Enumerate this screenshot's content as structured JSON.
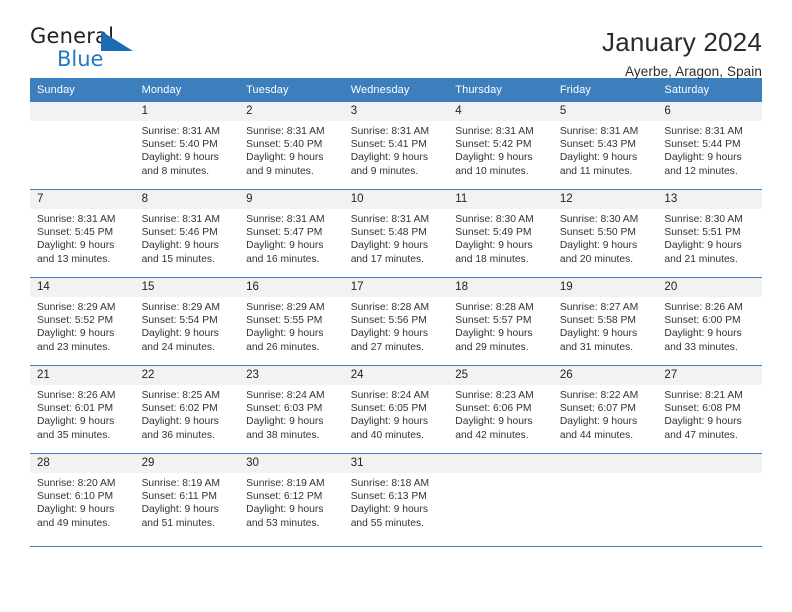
{
  "brand": {
    "name_part1": "General",
    "name_part2": "Blue",
    "color_blue": "#1f7ac4",
    "color_dark": "#231f20",
    "triangle_icon": "triangle-icon"
  },
  "header": {
    "title": "January 2024",
    "subtitle": "Ayerbe, Aragon, Spain"
  },
  "calendar": {
    "accent_color": "#3d7ebd",
    "daynum_bg": "#f2f2f2",
    "day_headers": [
      "Sunday",
      "Monday",
      "Tuesday",
      "Wednesday",
      "Thursday",
      "Friday",
      "Saturday"
    ],
    "weeks": [
      [
        {
          "day": "",
          "lines": []
        },
        {
          "day": "1",
          "lines": [
            "Sunrise: 8:31 AM",
            "Sunset: 5:40 PM",
            "Daylight: 9 hours",
            "and 8 minutes."
          ]
        },
        {
          "day": "2",
          "lines": [
            "Sunrise: 8:31 AM",
            "Sunset: 5:40 PM",
            "Daylight: 9 hours",
            "and 9 minutes."
          ]
        },
        {
          "day": "3",
          "lines": [
            "Sunrise: 8:31 AM",
            "Sunset: 5:41 PM",
            "Daylight: 9 hours",
            "and 9 minutes."
          ]
        },
        {
          "day": "4",
          "lines": [
            "Sunrise: 8:31 AM",
            "Sunset: 5:42 PM",
            "Daylight: 9 hours",
            "and 10 minutes."
          ]
        },
        {
          "day": "5",
          "lines": [
            "Sunrise: 8:31 AM",
            "Sunset: 5:43 PM",
            "Daylight: 9 hours",
            "and 11 minutes."
          ]
        },
        {
          "day": "6",
          "lines": [
            "Sunrise: 8:31 AM",
            "Sunset: 5:44 PM",
            "Daylight: 9 hours",
            "and 12 minutes."
          ]
        }
      ],
      [
        {
          "day": "7",
          "lines": [
            "Sunrise: 8:31 AM",
            "Sunset: 5:45 PM",
            "Daylight: 9 hours",
            "and 13 minutes."
          ]
        },
        {
          "day": "8",
          "lines": [
            "Sunrise: 8:31 AM",
            "Sunset: 5:46 PM",
            "Daylight: 9 hours",
            "and 15 minutes."
          ]
        },
        {
          "day": "9",
          "lines": [
            "Sunrise: 8:31 AM",
            "Sunset: 5:47 PM",
            "Daylight: 9 hours",
            "and 16 minutes."
          ]
        },
        {
          "day": "10",
          "lines": [
            "Sunrise: 8:31 AM",
            "Sunset: 5:48 PM",
            "Daylight: 9 hours",
            "and 17 minutes."
          ]
        },
        {
          "day": "11",
          "lines": [
            "Sunrise: 8:30 AM",
            "Sunset: 5:49 PM",
            "Daylight: 9 hours",
            "and 18 minutes."
          ]
        },
        {
          "day": "12",
          "lines": [
            "Sunrise: 8:30 AM",
            "Sunset: 5:50 PM",
            "Daylight: 9 hours",
            "and 20 minutes."
          ]
        },
        {
          "day": "13",
          "lines": [
            "Sunrise: 8:30 AM",
            "Sunset: 5:51 PM",
            "Daylight: 9 hours",
            "and 21 minutes."
          ]
        }
      ],
      [
        {
          "day": "14",
          "lines": [
            "Sunrise: 8:29 AM",
            "Sunset: 5:52 PM",
            "Daylight: 9 hours",
            "and 23 minutes."
          ]
        },
        {
          "day": "15",
          "lines": [
            "Sunrise: 8:29 AM",
            "Sunset: 5:54 PM",
            "Daylight: 9 hours",
            "and 24 minutes."
          ]
        },
        {
          "day": "16",
          "lines": [
            "Sunrise: 8:29 AM",
            "Sunset: 5:55 PM",
            "Daylight: 9 hours",
            "and 26 minutes."
          ]
        },
        {
          "day": "17",
          "lines": [
            "Sunrise: 8:28 AM",
            "Sunset: 5:56 PM",
            "Daylight: 9 hours",
            "and 27 minutes."
          ]
        },
        {
          "day": "18",
          "lines": [
            "Sunrise: 8:28 AM",
            "Sunset: 5:57 PM",
            "Daylight: 9 hours",
            "and 29 minutes."
          ]
        },
        {
          "day": "19",
          "lines": [
            "Sunrise: 8:27 AM",
            "Sunset: 5:58 PM",
            "Daylight: 9 hours",
            "and 31 minutes."
          ]
        },
        {
          "day": "20",
          "lines": [
            "Sunrise: 8:26 AM",
            "Sunset: 6:00 PM",
            "Daylight: 9 hours",
            "and 33 minutes."
          ]
        }
      ],
      [
        {
          "day": "21",
          "lines": [
            "Sunrise: 8:26 AM",
            "Sunset: 6:01 PM",
            "Daylight: 9 hours",
            "and 35 minutes."
          ]
        },
        {
          "day": "22",
          "lines": [
            "Sunrise: 8:25 AM",
            "Sunset: 6:02 PM",
            "Daylight: 9 hours",
            "and 36 minutes."
          ]
        },
        {
          "day": "23",
          "lines": [
            "Sunrise: 8:24 AM",
            "Sunset: 6:03 PM",
            "Daylight: 9 hours",
            "and 38 minutes."
          ]
        },
        {
          "day": "24",
          "lines": [
            "Sunrise: 8:24 AM",
            "Sunset: 6:05 PM",
            "Daylight: 9 hours",
            "and 40 minutes."
          ]
        },
        {
          "day": "25",
          "lines": [
            "Sunrise: 8:23 AM",
            "Sunset: 6:06 PM",
            "Daylight: 9 hours",
            "and 42 minutes."
          ]
        },
        {
          "day": "26",
          "lines": [
            "Sunrise: 8:22 AM",
            "Sunset: 6:07 PM",
            "Daylight: 9 hours",
            "and 44 minutes."
          ]
        },
        {
          "day": "27",
          "lines": [
            "Sunrise: 8:21 AM",
            "Sunset: 6:08 PM",
            "Daylight: 9 hours",
            "and 47 minutes."
          ]
        }
      ],
      [
        {
          "day": "28",
          "lines": [
            "Sunrise: 8:20 AM",
            "Sunset: 6:10 PM",
            "Daylight: 9 hours",
            "and 49 minutes."
          ]
        },
        {
          "day": "29",
          "lines": [
            "Sunrise: 8:19 AM",
            "Sunset: 6:11 PM",
            "Daylight: 9 hours",
            "and 51 minutes."
          ]
        },
        {
          "day": "30",
          "lines": [
            "Sunrise: 8:19 AM",
            "Sunset: 6:12 PM",
            "Daylight: 9 hours",
            "and 53 minutes."
          ]
        },
        {
          "day": "31",
          "lines": [
            "Sunrise: 8:18 AM",
            "Sunset: 6:13 PM",
            "Daylight: 9 hours",
            "and 55 minutes."
          ]
        },
        {
          "day": "",
          "lines": []
        },
        {
          "day": "",
          "lines": []
        },
        {
          "day": "",
          "lines": []
        }
      ]
    ]
  }
}
